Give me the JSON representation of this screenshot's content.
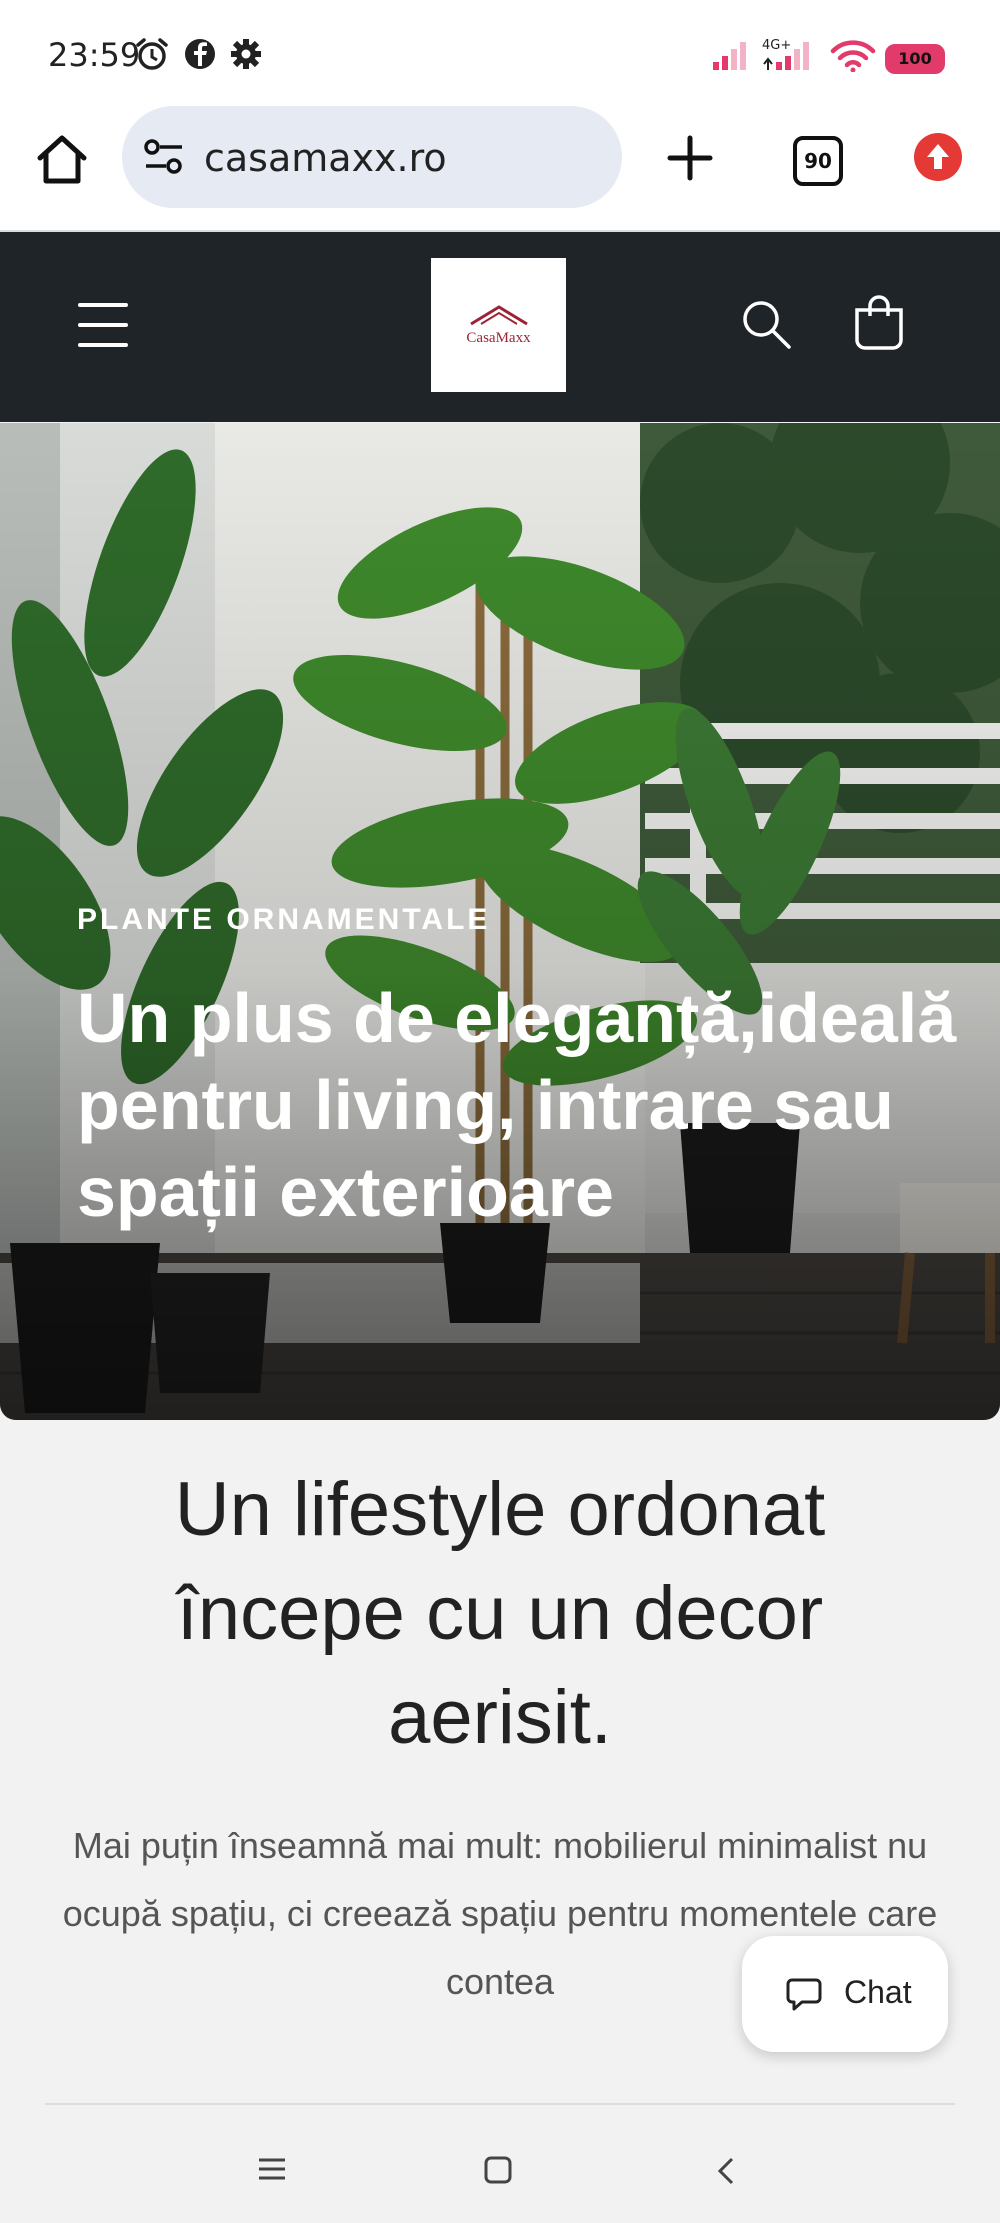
{
  "status_bar": {
    "time": "23:59",
    "network": "4G+",
    "battery": "100",
    "icons": [
      "alarm-icon",
      "facebook-icon",
      "settings-icon",
      "signal-icon",
      "wifi-icon",
      "battery-icon"
    ]
  },
  "browser": {
    "url": "casamaxx.ro",
    "tab_count": "90",
    "icons": [
      "home-icon",
      "site-settings-icon",
      "new-tab-icon",
      "tabs-icon",
      "update-icon"
    ]
  },
  "site_header": {
    "logo_text": "CasaMaxx",
    "icons": [
      "menu-icon",
      "search-icon",
      "cart-icon"
    ],
    "background": "#1f2429"
  },
  "hero": {
    "eyebrow": "PLANTE ORNAMENTALE",
    "title": "Un plus de eleganță,ideală pentru living, intrare sau spații exterioare"
  },
  "lifestyle": {
    "heading": "Un lifestyle ordonat începe cu un decor aerisit.",
    "text": "Mai puțin înseamnă mai mult: mobilierul minimalist nu ocupă spațiu, ci creează spațiu pentru momentele care contea"
  },
  "chat": {
    "label": "Chat",
    "icon": "chat-bubble-icon"
  },
  "nav_bar": {
    "icons": [
      "recent-apps-icon",
      "home-nav-icon",
      "back-icon"
    ]
  },
  "colors": {
    "accent": "#e23a6a",
    "update": "#e53935",
    "header_bg": "#1f2429"
  }
}
